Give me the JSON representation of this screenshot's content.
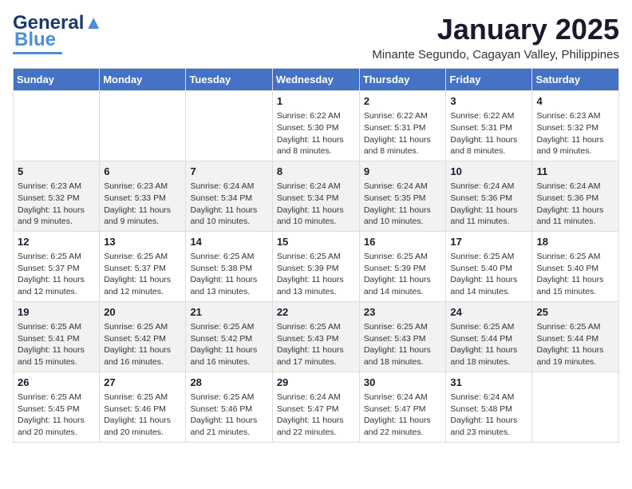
{
  "header": {
    "logo_general": "General",
    "logo_blue": "Blue",
    "month": "January 2025",
    "location": "Minante Segundo, Cagayan Valley, Philippines"
  },
  "days_of_week": [
    "Sunday",
    "Monday",
    "Tuesday",
    "Wednesday",
    "Thursday",
    "Friday",
    "Saturday"
  ],
  "weeks": [
    [
      {
        "day": "",
        "info": ""
      },
      {
        "day": "",
        "info": ""
      },
      {
        "day": "",
        "info": ""
      },
      {
        "day": "1",
        "info": "Sunrise: 6:22 AM\nSunset: 5:30 PM\nDaylight: 11 hours and 8 minutes."
      },
      {
        "day": "2",
        "info": "Sunrise: 6:22 AM\nSunset: 5:31 PM\nDaylight: 11 hours and 8 minutes."
      },
      {
        "day": "3",
        "info": "Sunrise: 6:22 AM\nSunset: 5:31 PM\nDaylight: 11 hours and 8 minutes."
      },
      {
        "day": "4",
        "info": "Sunrise: 6:23 AM\nSunset: 5:32 PM\nDaylight: 11 hours and 9 minutes."
      }
    ],
    [
      {
        "day": "5",
        "info": "Sunrise: 6:23 AM\nSunset: 5:32 PM\nDaylight: 11 hours and 9 minutes."
      },
      {
        "day": "6",
        "info": "Sunrise: 6:23 AM\nSunset: 5:33 PM\nDaylight: 11 hours and 9 minutes."
      },
      {
        "day": "7",
        "info": "Sunrise: 6:24 AM\nSunset: 5:34 PM\nDaylight: 11 hours and 10 minutes."
      },
      {
        "day": "8",
        "info": "Sunrise: 6:24 AM\nSunset: 5:34 PM\nDaylight: 11 hours and 10 minutes."
      },
      {
        "day": "9",
        "info": "Sunrise: 6:24 AM\nSunset: 5:35 PM\nDaylight: 11 hours and 10 minutes."
      },
      {
        "day": "10",
        "info": "Sunrise: 6:24 AM\nSunset: 5:36 PM\nDaylight: 11 hours and 11 minutes."
      },
      {
        "day": "11",
        "info": "Sunrise: 6:24 AM\nSunset: 5:36 PM\nDaylight: 11 hours and 11 minutes."
      }
    ],
    [
      {
        "day": "12",
        "info": "Sunrise: 6:25 AM\nSunset: 5:37 PM\nDaylight: 11 hours and 12 minutes."
      },
      {
        "day": "13",
        "info": "Sunrise: 6:25 AM\nSunset: 5:37 PM\nDaylight: 11 hours and 12 minutes."
      },
      {
        "day": "14",
        "info": "Sunrise: 6:25 AM\nSunset: 5:38 PM\nDaylight: 11 hours and 13 minutes."
      },
      {
        "day": "15",
        "info": "Sunrise: 6:25 AM\nSunset: 5:39 PM\nDaylight: 11 hours and 13 minutes."
      },
      {
        "day": "16",
        "info": "Sunrise: 6:25 AM\nSunset: 5:39 PM\nDaylight: 11 hours and 14 minutes."
      },
      {
        "day": "17",
        "info": "Sunrise: 6:25 AM\nSunset: 5:40 PM\nDaylight: 11 hours and 14 minutes."
      },
      {
        "day": "18",
        "info": "Sunrise: 6:25 AM\nSunset: 5:40 PM\nDaylight: 11 hours and 15 minutes."
      }
    ],
    [
      {
        "day": "19",
        "info": "Sunrise: 6:25 AM\nSunset: 5:41 PM\nDaylight: 11 hours and 15 minutes."
      },
      {
        "day": "20",
        "info": "Sunrise: 6:25 AM\nSunset: 5:42 PM\nDaylight: 11 hours and 16 minutes."
      },
      {
        "day": "21",
        "info": "Sunrise: 6:25 AM\nSunset: 5:42 PM\nDaylight: 11 hours and 16 minutes."
      },
      {
        "day": "22",
        "info": "Sunrise: 6:25 AM\nSunset: 5:43 PM\nDaylight: 11 hours and 17 minutes."
      },
      {
        "day": "23",
        "info": "Sunrise: 6:25 AM\nSunset: 5:43 PM\nDaylight: 11 hours and 18 minutes."
      },
      {
        "day": "24",
        "info": "Sunrise: 6:25 AM\nSunset: 5:44 PM\nDaylight: 11 hours and 18 minutes."
      },
      {
        "day": "25",
        "info": "Sunrise: 6:25 AM\nSunset: 5:44 PM\nDaylight: 11 hours and 19 minutes."
      }
    ],
    [
      {
        "day": "26",
        "info": "Sunrise: 6:25 AM\nSunset: 5:45 PM\nDaylight: 11 hours and 20 minutes."
      },
      {
        "day": "27",
        "info": "Sunrise: 6:25 AM\nSunset: 5:46 PM\nDaylight: 11 hours and 20 minutes."
      },
      {
        "day": "28",
        "info": "Sunrise: 6:25 AM\nSunset: 5:46 PM\nDaylight: 11 hours and 21 minutes."
      },
      {
        "day": "29",
        "info": "Sunrise: 6:24 AM\nSunset: 5:47 PM\nDaylight: 11 hours and 22 minutes."
      },
      {
        "day": "30",
        "info": "Sunrise: 6:24 AM\nSunset: 5:47 PM\nDaylight: 11 hours and 22 minutes."
      },
      {
        "day": "31",
        "info": "Sunrise: 6:24 AM\nSunset: 5:48 PM\nDaylight: 11 hours and 23 minutes."
      },
      {
        "day": "",
        "info": ""
      }
    ]
  ]
}
